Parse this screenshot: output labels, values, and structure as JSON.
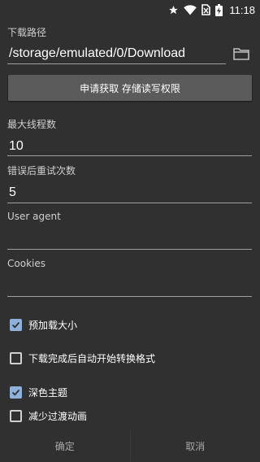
{
  "statusbar": {
    "time": "11:18",
    "icons": [
      "star-icon",
      "wifi-icon",
      "no-sim-icon",
      "battery-charging-icon"
    ]
  },
  "download_path": {
    "label": "下载路径",
    "value": "/storage/emulated/0/Download",
    "folder_icon": "folder-icon"
  },
  "permission_button": {
    "label": "申请获取 存储读写权限"
  },
  "max_threads": {
    "label": "最大线程数",
    "value": "10"
  },
  "retry_count": {
    "label": "错误后重试次数",
    "value": "5"
  },
  "user_agent": {
    "label": "User agent",
    "value": ""
  },
  "cookies": {
    "label": "Cookies",
    "value": ""
  },
  "checkboxes": [
    {
      "label": "预加载大小",
      "checked": true
    },
    {
      "label": "下载完成后自动开始转换格式",
      "checked": false
    },
    {
      "label": "深色主题",
      "checked": true
    },
    {
      "label": "减少过渡动画",
      "checked": false
    }
  ],
  "dialog_buttons": {
    "confirm": "确定",
    "cancel": "取消"
  },
  "colors": {
    "background": "#303030",
    "checkbox_accent": "#8fb0d9",
    "button": "#5b5b5b"
  }
}
